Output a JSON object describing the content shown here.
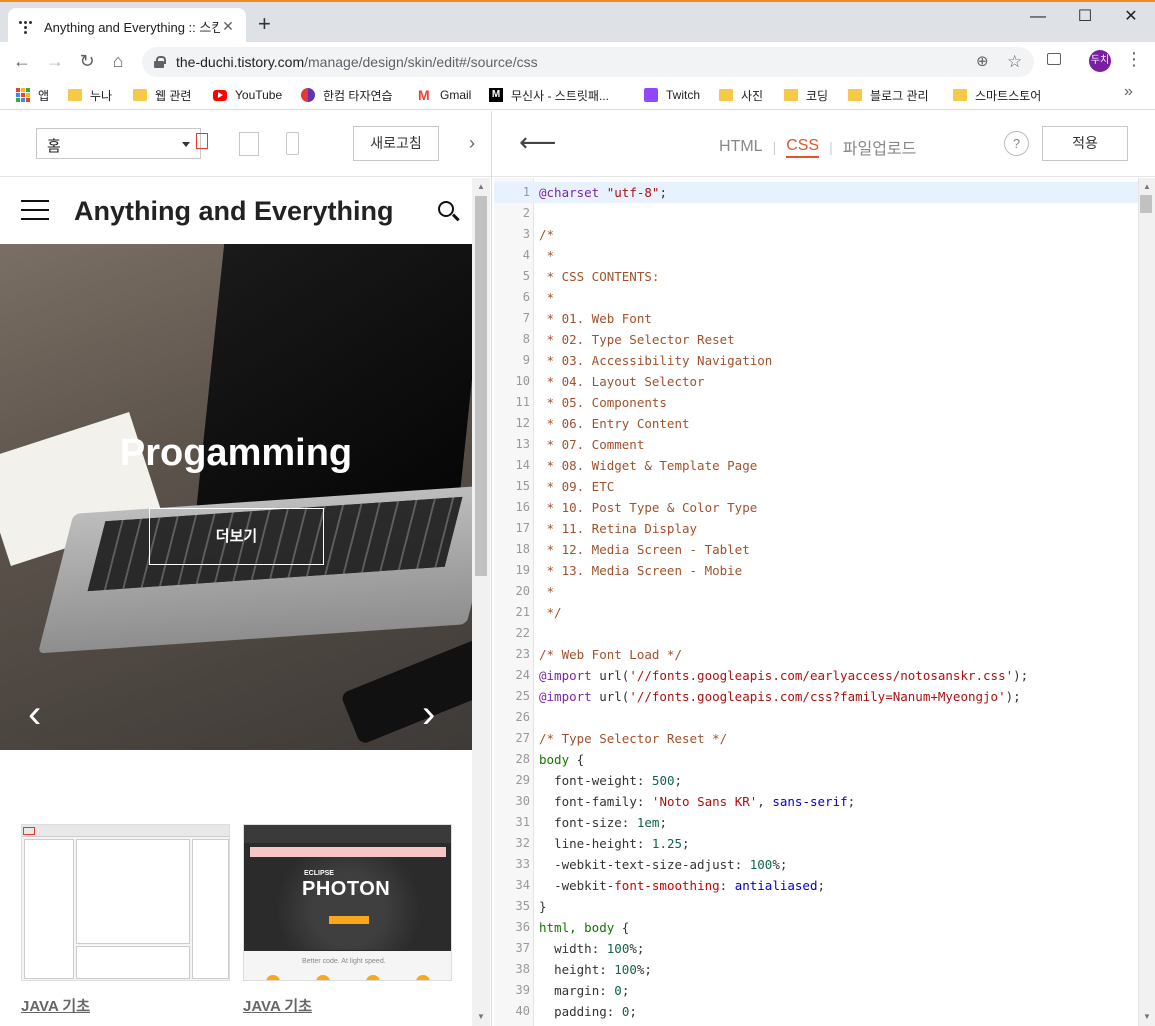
{
  "browser": {
    "tab_title": "Anything and Everything :: 스킨",
    "tab_close": "✕",
    "new_tab": "+",
    "min": "—",
    "max": "☐",
    "close": "✕",
    "url_host": "the-duchi.tistory.com",
    "url_path": "/manage/design/skin/edit#/source/css",
    "avatar": "두치",
    "back": "←",
    "forward": "→",
    "reload": "↻",
    "home": "⌂",
    "zoom_icon": "⊕",
    "star_icon": "☆",
    "more_icon": "⋮"
  },
  "bookmarks": {
    "items": [
      {
        "label": "앱",
        "icon": "apps-grid-icon"
      },
      {
        "label": "누나",
        "icon": "folder-icon"
      },
      {
        "label": "웹 관련",
        "icon": "folder-icon"
      },
      {
        "label": "YouTube",
        "icon": "youtube-icon"
      },
      {
        "label": "한컴 타자연습",
        "icon": "hancom-icon"
      },
      {
        "label": "Gmail",
        "icon": "gmail-icon"
      },
      {
        "label": "무신사 - 스트릿패...",
        "icon": "musinsa-icon"
      },
      {
        "label": "Twitch",
        "icon": "twitch-icon"
      },
      {
        "label": "사진",
        "icon": "folder-icon"
      },
      {
        "label": "코딩",
        "icon": "folder-icon"
      },
      {
        "label": "블로그 관리",
        "icon": "folder-icon"
      },
      {
        "label": "스마트스토어",
        "icon": "folder-icon"
      }
    ],
    "more": "»"
  },
  "editor_bar": {
    "page_select": "홈",
    "refresh": "새로고침",
    "collapse": "›",
    "back": "⟵",
    "modes": [
      "HTML",
      "CSS",
      "파일업로드"
    ],
    "active_mode": "CSS",
    "help": "?",
    "apply": "적용"
  },
  "preview": {
    "blog_title": "Anything and Everything",
    "hero_title": "Progamming",
    "hero_button": "더보기",
    "prev": "‹",
    "next": "›",
    "cards": [
      {
        "label": "JAVA 기초"
      },
      {
        "label": "JAVA 기초"
      }
    ],
    "eclipse_small": "ECLIPSE",
    "eclipse_big": "PHOTON",
    "eclipse_tag": "Better code. At light speed."
  },
  "code_lines": [
    "@charset \"utf-8\";",
    "",
    "/*",
    " *",
    " * CSS CONTENTS:",
    " *",
    " * 01. Web Font",
    " * 02. Type Selector Reset",
    " * 03. Accessibility Navigation",
    " * 04. Layout Selector",
    " * 05. Components",
    " * 06. Entry Content",
    " * 07. Comment",
    " * 08. Widget & Template Page",
    " * 09. ETC",
    " * 10. Post Type & Color Type",
    " * 11. Retina Display",
    " * 12. Media Screen - Tablet",
    " * 13. Media Screen - Mobie",
    " *",
    " */",
    "",
    "/* Web Font Load */",
    "@import url('//fonts.googleapis.com/earlyaccess/notosanskr.css');",
    "@import url('//fonts.googleapis.com/css?family=Nanum+Myeongjo');",
    "",
    "/* Type Selector Reset */",
    "body {",
    "  font-weight: 500;",
    "  font-family: 'Noto Sans KR', sans-serif;",
    "  font-size: 1em;",
    "  line-height: 1.25;",
    "  -webkit-text-size-adjust: 100%;",
    "  -webkit-font-smoothing: antialiased;",
    "}",
    "html, body {",
    "  width: 100%;",
    "  height: 100%;",
    "  margin: 0;",
    "  padding: 0;"
  ],
  "colors": {
    "accent": "#e0562c",
    "avatar_bg": "#7b1fa2"
  }
}
